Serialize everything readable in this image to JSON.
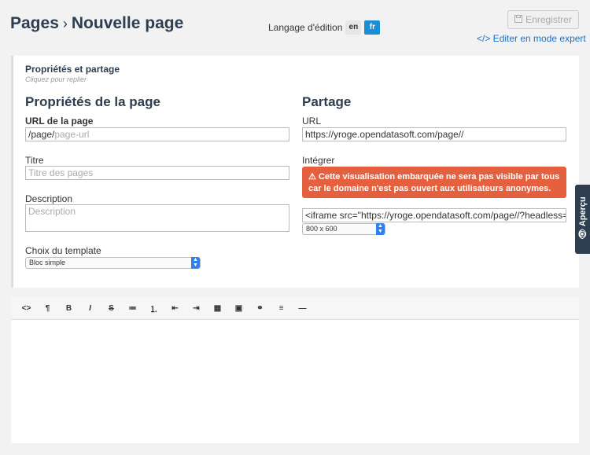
{
  "header": {
    "breadcrumb_parent": "Pages",
    "breadcrumb_sep": "›",
    "breadcrumb_current": "Nouvelle page",
    "lang_label": "Langage d'édition",
    "lang_en": "en",
    "lang_fr": "fr",
    "save_label": "Enregistrer",
    "expert_label": "</> Editer en mode expert"
  },
  "panel": {
    "title": "Propriétés et partage",
    "subtitle": "Cliquez pour replier"
  },
  "properties": {
    "heading": "Propriétés de la page",
    "url_label": "URL de la page",
    "url_prefix": "/page/",
    "url_placeholder": "page-url",
    "title_label": "Titre",
    "title_placeholder": "Titre des pages",
    "description_label": "Description",
    "description_placeholder": "Description",
    "template_label": "Choix du template",
    "template_value": "Bloc simple"
  },
  "sharing": {
    "heading": "Partage",
    "url_label": "URL",
    "url_value": "https://yroge.opendatasoft.com/page//",
    "embed_label": "Intégrer",
    "warning": "⚠ Cette visualisation embarquée ne sera pas visible par tous car le domaine n'est pas ouvert aux utilisateurs anonymes.",
    "iframe_value": "<iframe src=\"https://yroge.opendatasoft.com/page//?headless=t",
    "size_value": "800 x 600"
  },
  "apercu_label": "👁 Aperçu",
  "toolbar": {
    "buttons": [
      "<>",
      "¶",
      "B",
      "I",
      "S",
      "≔",
      "⒈",
      "⇤",
      "⇥",
      "▦",
      "▣",
      "⚭",
      "≡",
      "—"
    ]
  },
  "colors": {
    "heading": "#2d3e50",
    "accent_blue": "#1a8fd6",
    "warning": "#e5603f"
  }
}
